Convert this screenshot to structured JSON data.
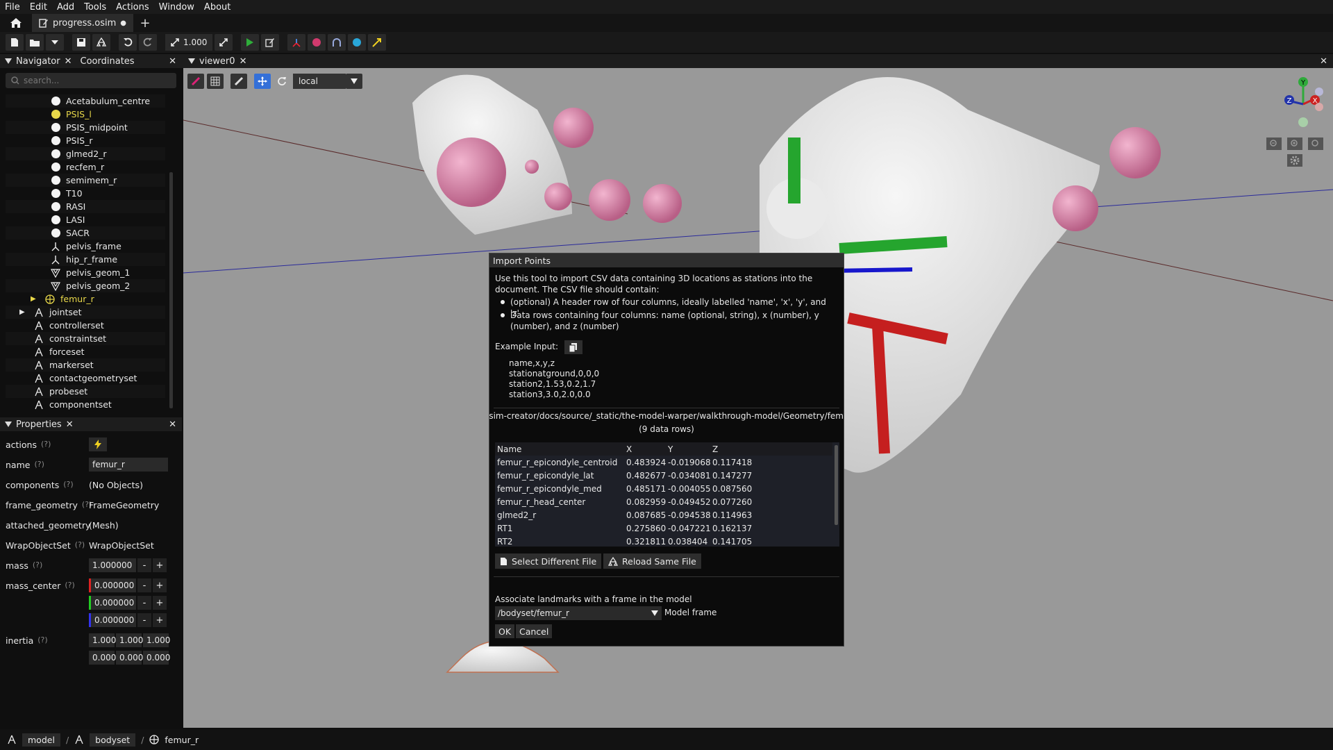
{
  "menubar": [
    "File",
    "Edit",
    "Add",
    "Tools",
    "Actions",
    "Window",
    "About"
  ],
  "tabs": {
    "file_tab_label": "progress.osim",
    "modified_marker": "●",
    "new_tab": "+"
  },
  "toolbar": {
    "scale_value": "1.000"
  },
  "navigator": {
    "tab_navigator": "Navigator",
    "tab_coordinates": "Coordinates",
    "search_placeholder": "search...",
    "items": [
      {
        "label": "Acetabulum_centre",
        "icon": "marker-dot-icon",
        "selected": false
      },
      {
        "label": "PSIS_l",
        "icon": "marker-dot-icon",
        "selected": true
      },
      {
        "label": "PSIS_midpoint",
        "icon": "marker-dot-icon",
        "selected": false
      },
      {
        "label": "PSIS_r",
        "icon": "marker-dot-icon",
        "selected": false
      },
      {
        "label": "glmed2_r",
        "icon": "marker-dot-icon",
        "selected": false
      },
      {
        "label": "recfem_r",
        "icon": "marker-dot-icon",
        "selected": false
      },
      {
        "label": "semimem_r",
        "icon": "marker-dot-icon",
        "selected": false
      },
      {
        "label": "T10",
        "icon": "marker-dot-icon",
        "selected": false
      },
      {
        "label": "RASI",
        "icon": "marker-dot-icon",
        "selected": false
      },
      {
        "label": "LASI",
        "icon": "marker-dot-icon",
        "selected": false
      },
      {
        "label": "SACR",
        "icon": "marker-dot-icon",
        "selected": false
      },
      {
        "label": "pelvis_frame",
        "icon": "frame-icon",
        "selected": false
      },
      {
        "label": "hip_r_frame",
        "icon": "frame-icon",
        "selected": false
      },
      {
        "label": "pelvis_geom_1",
        "icon": "mesh-icon",
        "selected": false
      },
      {
        "label": "pelvis_geom_2",
        "icon": "mesh-icon",
        "selected": false
      },
      {
        "label": "femur_r",
        "icon": "body-icon",
        "selected": true
      },
      {
        "label": "jointset",
        "icon": "set-icon",
        "selected": false
      },
      {
        "label": "controllerset",
        "icon": "set-icon",
        "selected": false
      },
      {
        "label": "constraintset",
        "icon": "set-icon",
        "selected": false
      },
      {
        "label": "forceset",
        "icon": "set-icon",
        "selected": false
      },
      {
        "label": "markerset",
        "icon": "set-icon",
        "selected": false
      },
      {
        "label": "contactgeometryset",
        "icon": "set-icon",
        "selected": false
      },
      {
        "label": "probeset",
        "icon": "set-icon",
        "selected": false
      },
      {
        "label": "componentset",
        "icon": "set-icon",
        "selected": false
      }
    ]
  },
  "properties": {
    "tab_label": "Properties",
    "help_marker": "(?)",
    "actions_label": "actions",
    "name_label": "name",
    "name_value": "femur_r",
    "components_label": "components",
    "components_value": "(No Objects)",
    "frame_geometry_label": "frame_geometry",
    "frame_geometry_value": "FrameGeometry",
    "attached_geometry_label": "attached_geometry",
    "attached_geometry_value": "(Mesh)",
    "wrapobjectset_label": "WrapObjectSet",
    "wrapobjectset_value": "WrapObjectSet",
    "mass_label": "mass",
    "mass_value": "1.000000",
    "mass_center_label": "mass_center",
    "mass_center_values": [
      "0.000000",
      "0.000000",
      "0.000000"
    ],
    "inertia_label": "inertia",
    "inertia_values": [
      "1.000",
      "1.000",
      "1.000",
      "0.000",
      "0.000",
      "0.000"
    ],
    "minus": "-",
    "plus": "+"
  },
  "viewer": {
    "tab_label": "viewer0",
    "frame_select_value": "local",
    "axis_labels": {
      "x": "X",
      "y": "Y",
      "z": "Z"
    }
  },
  "dialog": {
    "title": "Import Points",
    "intro": "Use this tool to import CSV data containing 3D locations as stations into the document. The CSV file should contain:",
    "bullet1": "(optional) A header row of four columns, ideally labelled 'name', 'x', 'y', and 'z'",
    "bullet2": "Data rows containing four columns: name (optional, string), x (number), y (number), and z (number)",
    "example_label": "Example Input:",
    "example_lines": [
      "name,x,y,z",
      "stationatground,0,0,0",
      "station2,1.53,0.2,1.7",
      "station3,3.0,2.0,0.0"
    ],
    "file_path": "sim-creator/docs/source/_static/the-model-warper/walkthrough-model/Geometry/fem",
    "row_count": "(9 data rows)",
    "columns": [
      "Name",
      "X",
      "Y",
      "Z"
    ],
    "rows": [
      [
        "femur_r_epicondyle_centroid",
        "0.483924",
        "-0.019068",
        "0.117418"
      ],
      [
        "femur_r_epicondyle_lat",
        "0.482677",
        "-0.034081",
        "0.147277"
      ],
      [
        "femur_r_epicondyle_med",
        "0.485171",
        "-0.004055",
        "0.087560"
      ],
      [
        "femur_r_head_center",
        "0.082959",
        "-0.049452",
        "0.077260"
      ],
      [
        "glmed2_r",
        "0.087685",
        "-0.094538",
        "0.114963"
      ],
      [
        "RT1",
        "0.275860",
        "-0.047221",
        "0.162137"
      ],
      [
        "RT2",
        "0.321811",
        "0.038404",
        "0.141705"
      ]
    ],
    "select_different_file": "Select Different File",
    "reload_same_file": "Reload Same File",
    "associate_label": "Associate landmarks with a frame in the model",
    "frame_value": "/bodyset/femur_r",
    "model_frame_label": "Model frame",
    "ok": "OK",
    "cancel": "Cancel"
  },
  "statusbar": {
    "crumbs": [
      "model",
      "bodyset",
      "femur_r"
    ],
    "separator": "/"
  },
  "colors": {
    "accent_blue": "#3470d8",
    "selected_yellow": "#e8d84a",
    "viewport_bg": "#999999",
    "marker_pink": "#d57fa5"
  }
}
